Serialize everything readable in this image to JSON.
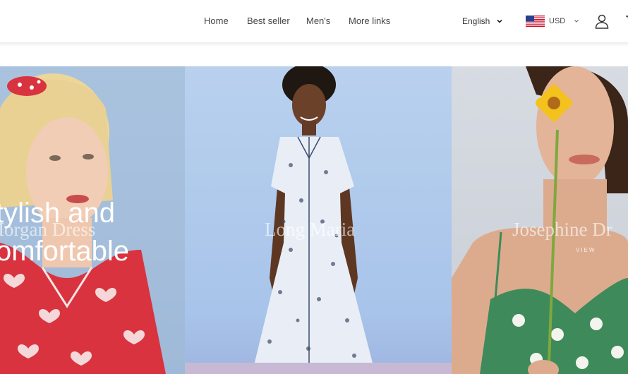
{
  "nav": {
    "links": [
      {
        "label": "Home"
      },
      {
        "label": "Best seller"
      },
      {
        "label": "Men's"
      },
      {
        "label": "More links"
      }
    ]
  },
  "language": {
    "selected": "English"
  },
  "currency": {
    "selected": "USD",
    "flag_icon": "us-flag-icon"
  },
  "icons": {
    "account": "user-icon",
    "cart": "cart-icon"
  },
  "hero": {
    "line1": "tylish and",
    "line2": "omfortable"
  },
  "collections": [
    {
      "title": "Morgan Dress",
      "view_label": ""
    },
    {
      "title": "Long Maria",
      "view_label": ""
    },
    {
      "title": "Josephine Dr",
      "view_label": "VIEW"
    }
  ],
  "colors": {
    "panel1_bg": "#a9c3df",
    "panel2_bg": "#b9d1ee",
    "panel3_bg": "#d7dbe2",
    "red_dress": "#d9333f",
    "green_dress": "#3e8a5a",
    "flower": "#f3c21c"
  }
}
